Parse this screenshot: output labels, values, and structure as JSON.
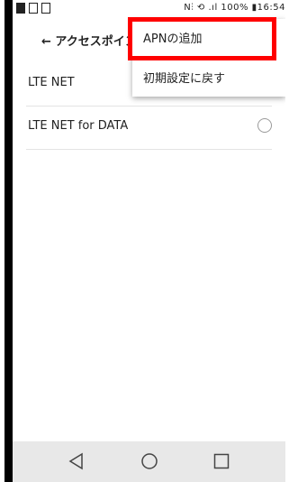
{
  "status_bar": {
    "right_text": "N⫶ ⟲ .ıl 100% ▮16:54"
  },
  "app_bar": {
    "back_icon": "arrow-left-icon",
    "title": "← アクセスポイン"
  },
  "apn_list": {
    "items": [
      {
        "label": "LTE NET"
      },
      {
        "label": "LTE NET for DATA"
      }
    ]
  },
  "overflow_menu": {
    "items": [
      {
        "label": "APNの追加"
      },
      {
        "label": "初期設定に戻す"
      }
    ]
  },
  "highlight_color": "#ff0000",
  "nav_bar": {
    "icons": [
      "back-triangle-icon",
      "home-circle-icon",
      "recent-square-icon"
    ]
  }
}
